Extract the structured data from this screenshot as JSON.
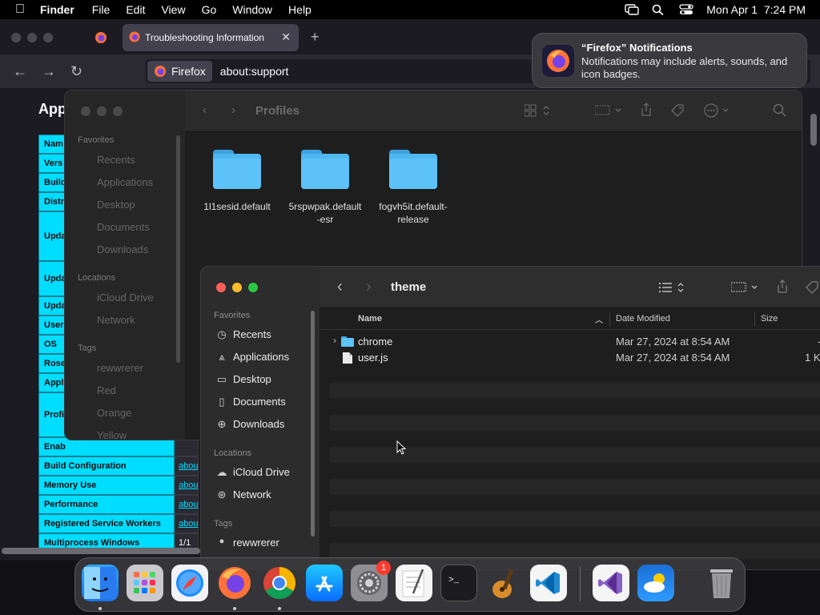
{
  "menubar": {
    "app": "Finder",
    "items": [
      "File",
      "Edit",
      "View",
      "Go",
      "Window",
      "Help"
    ],
    "clock": "Mon Apr 1  7:24 PM"
  },
  "firefox": {
    "tab_title": "Troubleshooting Information",
    "url_identity": "Firefox",
    "url": "about:support",
    "heading": "App",
    "table": [
      {
        "key": "Nam",
        "val": ""
      },
      {
        "key": "Vers",
        "val": ""
      },
      {
        "key": "Build",
        "val": ""
      },
      {
        "key": "Distr",
        "val": ""
      },
      {
        "key": "Upda",
        "val": ""
      },
      {
        "key": "Upda",
        "val": ""
      },
      {
        "key": "Upda",
        "val": ""
      },
      {
        "key": "User",
        "val": ""
      },
      {
        "key": "OS",
        "val": ""
      },
      {
        "key": "Rose",
        "val": ""
      },
      {
        "key": "Appl",
        "val": ""
      },
      {
        "key": "Profi",
        "val": ""
      },
      {
        "key": "Enab",
        "val": ""
      },
      {
        "key": "Build Configuration",
        "val": "abou"
      },
      {
        "key": "Memory Use",
        "val": "abou"
      },
      {
        "key": "Performance",
        "val": "abou"
      },
      {
        "key": "Registered Service Workers",
        "val": "abou"
      },
      {
        "key": "Multiprocess Windows",
        "val": "1/1"
      }
    ]
  },
  "notification": {
    "title": "“Firefox” Notifications",
    "body": "Notifications may include alerts, sounds, and icon badges."
  },
  "finder_profiles": {
    "title": "Profiles",
    "sidebar": {
      "favorites_label": "Favorites",
      "favorites": [
        "Recents",
        "Applications",
        "Desktop",
        "Documents",
        "Downloads"
      ],
      "locations_label": "Locations",
      "locations": [
        "iCloud Drive",
        "Network"
      ],
      "tags_label": "Tags",
      "tags": [
        "rewwrerer",
        "Red",
        "Orange",
        "Yellow"
      ]
    },
    "folders": [
      {
        "line1": "1l1sesid.default",
        "line2": ""
      },
      {
        "line1": "5rspwpak.default",
        "line2": "-esr"
      },
      {
        "line1": "fogvh5it.default-",
        "line2": "release"
      }
    ]
  },
  "finder_theme": {
    "title": "theme",
    "sidebar": {
      "favorites_label": "Favorites",
      "favorites": [
        "Recents",
        "Applications",
        "Desktop",
        "Documents",
        "Downloads"
      ],
      "locations_label": "Locations",
      "locations": [
        "iCloud Drive",
        "Network"
      ],
      "tags_label": "Tags",
      "tags": [
        "rewwrerer"
      ]
    },
    "columns": {
      "name": "Name",
      "date": "Date Modified",
      "size": "Size"
    },
    "files": [
      {
        "name": "chrome",
        "date": "Mar 27, 2024 at 8:54 AM",
        "size": "-"
      },
      {
        "name": "user.js",
        "date": "Mar 27, 2024 at 8:54 AM",
        "size": "1 K"
      }
    ]
  },
  "dock": {
    "settings_badge": "1",
    "partial_label": "Yellow"
  }
}
